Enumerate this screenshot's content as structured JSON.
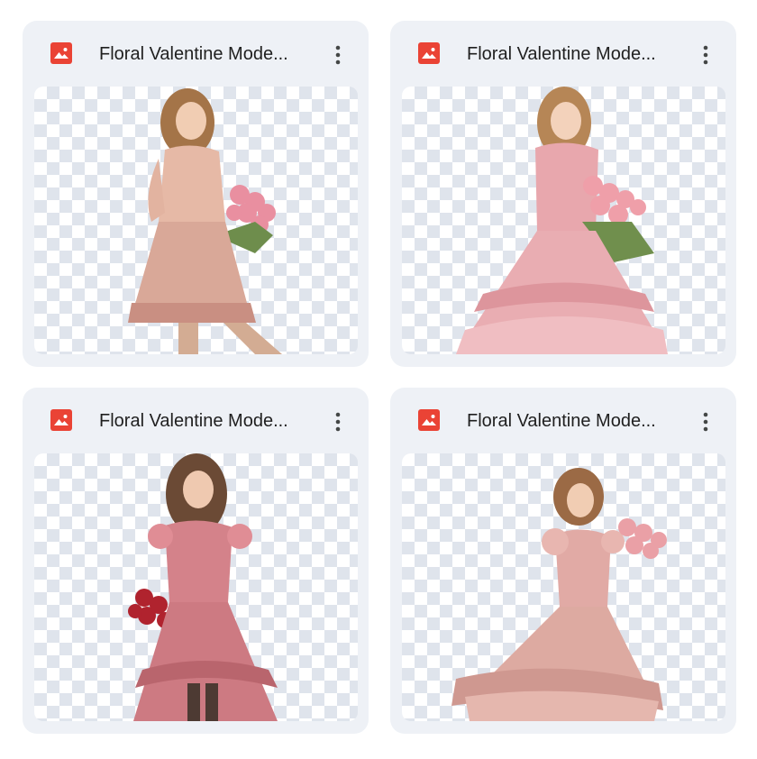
{
  "files": [
    {
      "title": "Floral Valentine Mode...",
      "icon": "image-file-icon",
      "menu_icon": "more-vert-icon"
    },
    {
      "title": "Floral Valentine Mode...",
      "icon": "image-file-icon",
      "menu_icon": "more-vert-icon"
    },
    {
      "title": "Floral Valentine Mode...",
      "icon": "image-file-icon",
      "menu_icon": "more-vert-icon"
    },
    {
      "title": "Floral Valentine Mode...",
      "icon": "image-file-icon",
      "menu_icon": "more-vert-icon"
    }
  ],
  "colors": {
    "card_bg": "#eef1f6",
    "icon_red": "#ea4335",
    "title_text": "#1f1f1f",
    "checker": "#dfe4ec"
  }
}
